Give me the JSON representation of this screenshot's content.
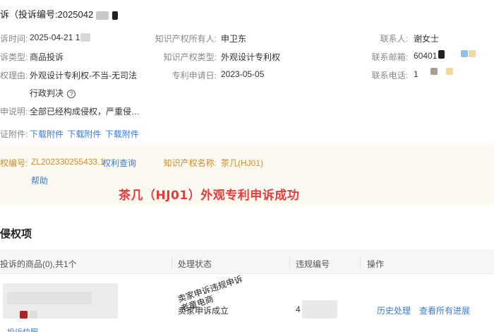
{
  "header": {
    "title_prefix": "诉（投诉编号:2025042"
  },
  "complaint": {
    "time_label": "诉时间:",
    "time_value": "2025-04-21 1",
    "type_label": "诉类型:",
    "type_value": "商品投诉",
    "reason_label": "权理由:",
    "reason_value": "外观设计专利权-不当-无司法",
    "reason_value2": "行政判决",
    "desc_label": "申说明:",
    "desc_value": "全部已经构成侵权，严重侵…",
    "attach_label": "证附件:",
    "attach_links": [
      "下载附件",
      "下载附件",
      "下载附件"
    ]
  },
  "ip": {
    "owner_label": "知识产权所有人:",
    "owner_value": "申卫东",
    "iptype_label": "知识产权类型:",
    "iptype_value": "外观设计专利权",
    "apply_label": "专利申请日:",
    "apply_value": "2023-05-05"
  },
  "contact": {
    "person_label": "联系人:",
    "person_value": "谢女士",
    "email_label": "联系邮箱:",
    "email_value": "60401",
    "phone_label": "联系电话:",
    "phone_value": "1"
  },
  "rights": {
    "number_label": "权编号:",
    "number_value": "ZL202330255433.1",
    "query_link": "权利查询",
    "name_label": "知识产权名称:",
    "name_value": "茶几(HJ01)",
    "help_link": "帮助"
  },
  "banner": {
    "text": "茶几（HJ01）外观专利申诉成功"
  },
  "section": {
    "title": "侵权项"
  },
  "table": {
    "headers": [
      "投诉的商品(0),共1个",
      "处理状态",
      "违规编号",
      "操作"
    ],
    "row": {
      "status": "卖家申诉成立",
      "violation_no": "4",
      "actions": [
        "历史处理",
        "查看所有进展"
      ],
      "bottom_link": "投诉快照"
    }
  },
  "overlay": {
    "stamp_line1": "卖家申诉违规申诉",
    "stamp_line2": "老童电商"
  },
  "colors": {
    "link": "#3a7bd5",
    "banner": "#e53b3b",
    "orange": "#d08a2a",
    "band": "#fdfaf1"
  }
}
